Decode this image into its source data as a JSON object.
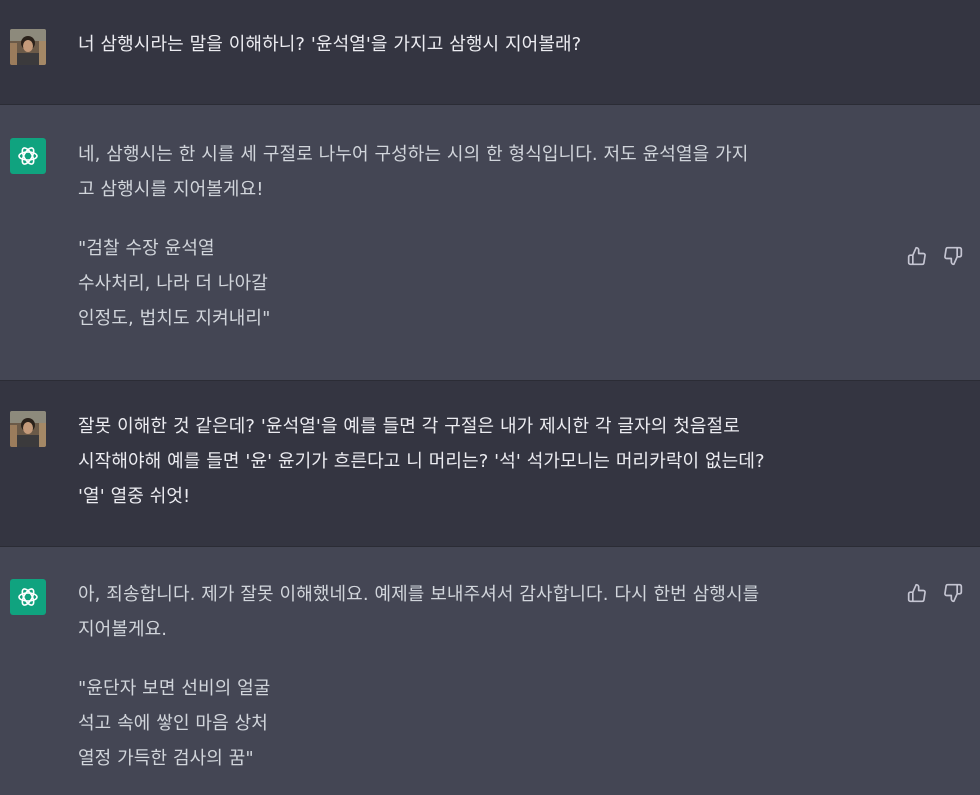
{
  "conversation": {
    "messages": [
      {
        "role": "user",
        "lines": [
          "너 삼행시라는 말을 이해하니? '윤석열'을 가지고 삼행시 지어볼래?"
        ]
      },
      {
        "role": "assistant",
        "lines": [
          "네, 삼행시는 한 시를 세 구절로 나누어 구성하는 시의 한 형식입니다. 저도 윤석열을 가지",
          "고 삼행시를 지어볼게요!"
        ],
        "poem": [
          "\"검찰 수장 윤석열",
          "수사처리, 나라 더 나아갈",
          "인정도, 법치도 지켜내리\""
        ]
      },
      {
        "role": "user",
        "lines": [
          "잘못 이해한 것 같은데? '윤석열'을 예를 들면 각 구절은 내가 제시한 각 글자의 첫음절로",
          "시작해야해 예를 들면 '윤' 윤기가 흐른다고 니 머리는? '석' 석가모니는 머리카락이 없는데?",
          "'열' 열중 쉬엇!"
        ]
      },
      {
        "role": "assistant",
        "lines": [
          "아, 죄송합니다. 제가 잘못 이해했네요. 예제를 보내주셔서 감사합니다. 다시 한번 삼행시를",
          "지어볼게요."
        ],
        "poem": [
          "\"윤단자 보면 선비의 얼굴",
          "석고 속에 쌓인 마음 상처",
          "열정 가득한 검사의 꿈\""
        ]
      }
    ]
  },
  "icons": {
    "user_avatar": "user-photo-avatar",
    "bot_avatar": "chatgpt-logo-icon",
    "thumbs_up": "thumbs-up-icon",
    "thumbs_down": "thumbs-down-icon"
  },
  "colors": {
    "user_bg": "#343541",
    "assistant_bg": "#444654",
    "bot_avatar_bg": "#10a37f"
  }
}
